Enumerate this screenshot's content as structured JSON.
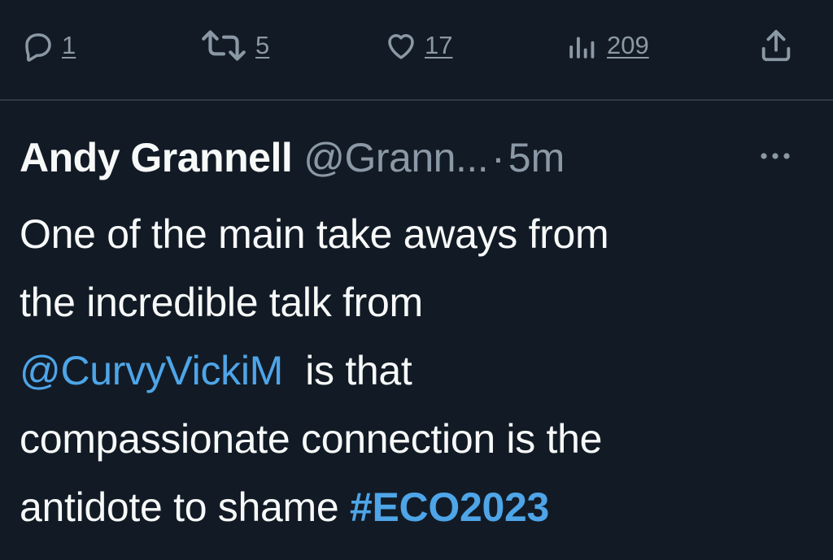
{
  "actions": {
    "reply": {
      "count": "1",
      "icon": "reply-icon"
    },
    "retweet": {
      "count": "5",
      "icon": "retweet-icon"
    },
    "like": {
      "count": "17",
      "icon": "heart-icon"
    },
    "views": {
      "count": "209",
      "icon": "views-chart-icon"
    },
    "share": {
      "icon": "share-icon"
    }
  },
  "tweet": {
    "author_name": "Andy Grannell",
    "author_handle": "@Grann...",
    "separator": "·",
    "time": "5m",
    "more_icon": "more-dots-icon",
    "lines": [
      {
        "text": "One of the main take aways from"
      },
      {
        "text": "the incredible talk from"
      },
      {
        "mention": "@CurvyVickiM",
        "text": "  is that"
      },
      {
        "text": "compassionate connection is the"
      },
      {
        "text": "antidote to shame ",
        "hashtag": "#ECO2023"
      }
    ]
  },
  "colors": {
    "background": "#121b25",
    "text": "#f7f9f9",
    "muted": "#8b98a5",
    "link": "#4ea5e8",
    "divider": "#2f3a45"
  }
}
